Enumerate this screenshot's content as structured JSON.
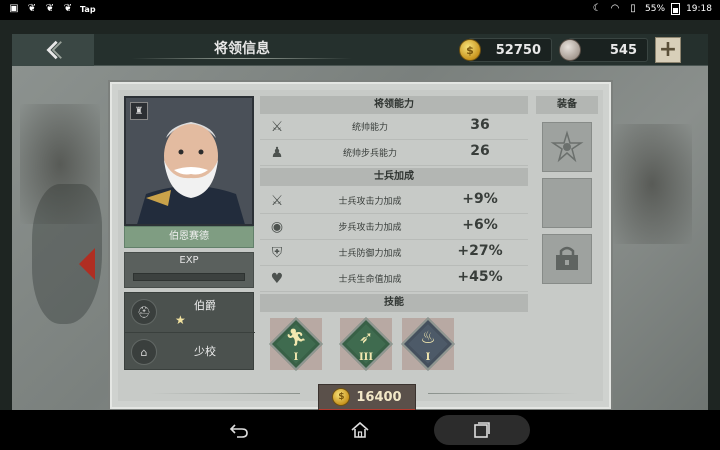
{
  "status_bar": {
    "left_icons": [
      "image-icon",
      "squirrel-icon",
      "squirrel-icon",
      "squirrel-icon"
    ],
    "app_tag": "Tap",
    "battery": "55%",
    "time": "19:18"
  },
  "header": {
    "title": "将领信息",
    "gold": "52750",
    "medals": "545"
  },
  "general": {
    "name": "伯恩赛德",
    "exp_label": "EXP",
    "exp_progress": 0,
    "rank_title": "伯爵",
    "rank_stars": "★",
    "military_rank": "少校"
  },
  "abilities": {
    "header": "将领能力",
    "rows": [
      {
        "icon": "crossed-swords-icon",
        "label": "统帅能力",
        "value": "36"
      },
      {
        "icon": "infantry-soldier-icon",
        "label": "统帅步兵能力",
        "value": "26"
      }
    ]
  },
  "soldier_bonus": {
    "header": "士兵加成",
    "rows": [
      {
        "icon": "attack-plus-icon",
        "label": "士兵攻击力加成",
        "value": "+9%"
      },
      {
        "icon": "infantry-attack-plus-icon",
        "label": "步兵攻击力加成",
        "value": "+6%"
      },
      {
        "icon": "defense-shield-icon",
        "label": "士兵防御力加成",
        "value": "+27%"
      },
      {
        "icon": "health-heart-icon",
        "label": "士兵生命值加成",
        "value": "+45%"
      }
    ]
  },
  "skills": {
    "header": "技能",
    "items": [
      {
        "icon": "running-soldier-icon",
        "level": "I",
        "color": "#3f6b4f"
      },
      {
        "icon": "prone-soldier-icon",
        "level": "III",
        "color": "#3f6b4f"
      },
      {
        "icon": "fire-icon",
        "level": "I",
        "color": "#4d5a68"
      }
    ]
  },
  "equipment": {
    "header": "装备",
    "slots": [
      "medal-star-icon",
      "empty-slot",
      "chest-lock-icon"
    ]
  },
  "price": {
    "value": "16400"
  },
  "colors": {
    "accent_red": "#b23a2e",
    "panel": "#c7cac7",
    "name_plate": "#7f9d82"
  }
}
